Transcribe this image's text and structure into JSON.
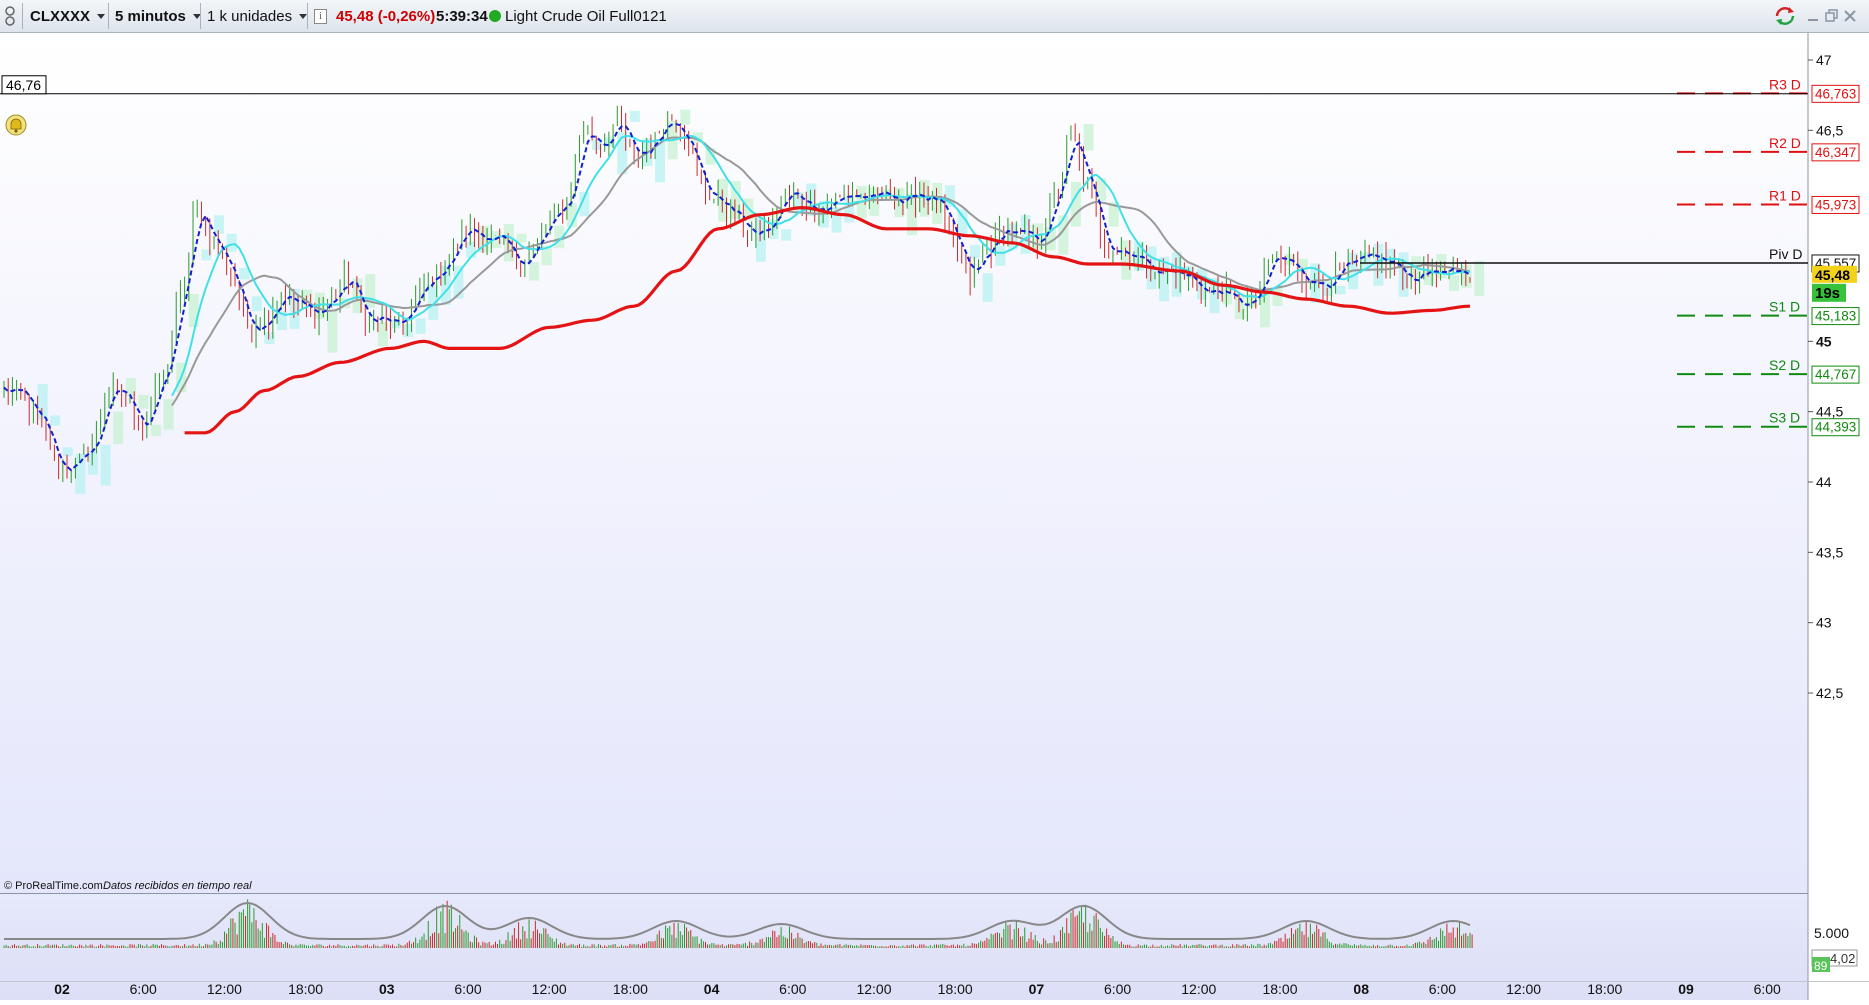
{
  "toolbar": {
    "symbol": "CLXXXX",
    "timeframe": "5 minutos",
    "units": "1 k unidades",
    "price": "45,48 (-0,26%)",
    "time": "5:39:34",
    "instrument": "Light Crude Oil Full0121",
    "status_color": "#22aa22",
    "price_color": "#cc0000"
  },
  "chart": {
    "cursor_price": "46,76",
    "current_price": "45,48",
    "countdown": "19s",
    "copyright": "© ProRealTime.com",
    "data_status": "Datos recibidos en tiempo real",
    "pivots": [
      {
        "label": "R3 D",
        "value": "46,763",
        "color": "#e01010"
      },
      {
        "label": "R2 D",
        "value": "46,347",
        "color": "#e01010"
      },
      {
        "label": "R1 D",
        "value": "45,973",
        "color": "#e01010"
      },
      {
        "label": "Piv D",
        "value": "45,557",
        "color": "#111111"
      },
      {
        "label": "S1 D",
        "value": "45,183",
        "color": "#108a10"
      },
      {
        "label": "S2 D",
        "value": "44,767",
        "color": "#108a10"
      },
      {
        "label": "S3 D",
        "value": "44,393",
        "color": "#108a10"
      }
    ],
    "price_ticks": [
      {
        "label": "47",
        "v": 47.0
      },
      {
        "label": "46,5",
        "v": 46.5
      },
      {
        "label": "45",
        "v": 45.0,
        "bold": true
      },
      {
        "label": "44,5",
        "v": 44.5
      },
      {
        "label": "44",
        "v": 44.0
      },
      {
        "label": "43,5",
        "v": 43.5
      },
      {
        "label": "43",
        "v": 43.0
      },
      {
        "label": "42,5",
        "v": 42.5
      }
    ],
    "volume_label": "5.000",
    "volume_current": "4,02",
    "volume_badge": "89",
    "time_labels": [
      {
        "label": "02",
        "bold": true
      },
      {
        "label": "6:00"
      },
      {
        "label": "12:00"
      },
      {
        "label": "18:00"
      },
      {
        "label": "03",
        "bold": true
      },
      {
        "label": "6:00"
      },
      {
        "label": "12:00"
      },
      {
        "label": "18:00"
      },
      {
        "label": "04",
        "bold": true
      },
      {
        "label": "6:00"
      },
      {
        "label": "12:00"
      },
      {
        "label": "18:00"
      },
      {
        "label": "07",
        "bold": true
      },
      {
        "label": "6:00"
      },
      {
        "label": "12:00"
      },
      {
        "label": "18:00"
      },
      {
        "label": "08",
        "bold": true
      },
      {
        "label": "6:00"
      },
      {
        "label": "12:00"
      },
      {
        "label": "18:00"
      },
      {
        "label": "09",
        "bold": true
      },
      {
        "label": "6:00"
      }
    ]
  },
  "series": {
    "price_anchors": [
      [
        0,
        44.65
      ],
      [
        4,
        44.62
      ],
      [
        9,
        44.4
      ],
      [
        13,
        44.1
      ],
      [
        17,
        44.13
      ],
      [
        21,
        44.25
      ],
      [
        25,
        44.65
      ],
      [
        29,
        44.6
      ],
      [
        33,
        44.4
      ],
      [
        38,
        44.75
      ],
      [
        42,
        45.3
      ],
      [
        46,
        45.95
      ],
      [
        50,
        45.7
      ],
      [
        54,
        45.5
      ],
      [
        58,
        45.1
      ],
      [
        62,
        45.15
      ],
      [
        66,
        45.35
      ],
      [
        70,
        45.25
      ],
      [
        74,
        45.2
      ],
      [
        78,
        45.3
      ],
      [
        82,
        45.45
      ],
      [
        86,
        45.15
      ],
      [
        90,
        45.15
      ],
      [
        94,
        45.1
      ],
      [
        98,
        45.3
      ],
      [
        102,
        45.45
      ],
      [
        106,
        45.6
      ],
      [
        110,
        45.8
      ],
      [
        114,
        45.75
      ],
      [
        118,
        45.7
      ],
      [
        122,
        45.55
      ],
      [
        126,
        45.65
      ],
      [
        130,
        45.85
      ],
      [
        134,
        46.0
      ],
      [
        138,
        46.5
      ],
      [
        142,
        46.4
      ],
      [
        146,
        46.55
      ],
      [
        150,
        46.3
      ],
      [
        154,
        46.4
      ],
      [
        158,
        46.6
      ],
      [
        162,
        46.5
      ],
      [
        166,
        46.1
      ],
      [
        170,
        46.0
      ],
      [
        174,
        45.9
      ],
      [
        178,
        45.75
      ],
      [
        182,
        45.8
      ],
      [
        186,
        46.05
      ],
      [
        190,
        46.0
      ],
      [
        194,
        45.95
      ],
      [
        198,
        46.0
      ],
      [
        202,
        46.05
      ],
      [
        206,
        46.0
      ],
      [
        210,
        46.05
      ],
      [
        214,
        46.0
      ],
      [
        218,
        46.05
      ],
      [
        222,
        46.0
      ],
      [
        226,
        45.7
      ],
      [
        230,
        45.45
      ],
      [
        234,
        45.65
      ],
      [
        238,
        45.8
      ],
      [
        242,
        45.75
      ],
      [
        246,
        45.7
      ],
      [
        250,
        46.0
      ],
      [
        254,
        46.45
      ],
      [
        258,
        46.1
      ],
      [
        262,
        45.7
      ],
      [
        266,
        45.65
      ],
      [
        270,
        45.6
      ],
      [
        274,
        45.5
      ],
      [
        278,
        45.5
      ],
      [
        282,
        45.45
      ],
      [
        286,
        45.35
      ],
      [
        290,
        45.35
      ],
      [
        294,
        45.25
      ],
      [
        298,
        45.3
      ],
      [
        302,
        45.6
      ],
      [
        306,
        45.55
      ],
      [
        310,
        45.45
      ],
      [
        314,
        45.4
      ],
      [
        318,
        45.5
      ],
      [
        322,
        45.55
      ],
      [
        326,
        45.6
      ],
      [
        330,
        45.55
      ],
      [
        334,
        45.45
      ],
      [
        338,
        45.5
      ],
      [
        342,
        45.5
      ],
      [
        346,
        45.45
      ],
      [
        349,
        45.48
      ]
    ],
    "red_anchors": [
      [
        43,
        44.35
      ],
      [
        48,
        44.35
      ],
      [
        55,
        44.5
      ],
      [
        62,
        44.65
      ],
      [
        70,
        44.75
      ],
      [
        80,
        44.85
      ],
      [
        92,
        44.95
      ],
      [
        100,
        45.0
      ],
      [
        106,
        44.95
      ],
      [
        118,
        44.95
      ],
      [
        130,
        45.1
      ],
      [
        140,
        45.15
      ],
      [
        150,
        45.25
      ],
      [
        160,
        45.5
      ],
      [
        170,
        45.8
      ],
      [
        180,
        45.9
      ],
      [
        190,
        45.95
      ],
      [
        200,
        45.9
      ],
      [
        210,
        45.8
      ],
      [
        220,
        45.8
      ],
      [
        230,
        45.75
      ],
      [
        240,
        45.7
      ],
      [
        250,
        45.6
      ],
      [
        258,
        45.55
      ],
      [
        266,
        45.55
      ],
      [
        280,
        45.5
      ],
      [
        290,
        45.4
      ],
      [
        300,
        45.35
      ],
      [
        310,
        45.3
      ],
      [
        320,
        45.25
      ],
      [
        330,
        45.2
      ],
      [
        340,
        45.22
      ],
      [
        349,
        45.25
      ]
    ],
    "volume_peaks": [
      [
        58,
        0.6
      ],
      [
        105,
        0.55
      ],
      [
        125,
        0.35
      ],
      [
        160,
        0.3
      ],
      [
        185,
        0.25
      ],
      [
        240,
        0.3
      ],
      [
        257,
        0.55
      ],
      [
        310,
        0.3
      ],
      [
        345,
        0.3
      ]
    ]
  }
}
